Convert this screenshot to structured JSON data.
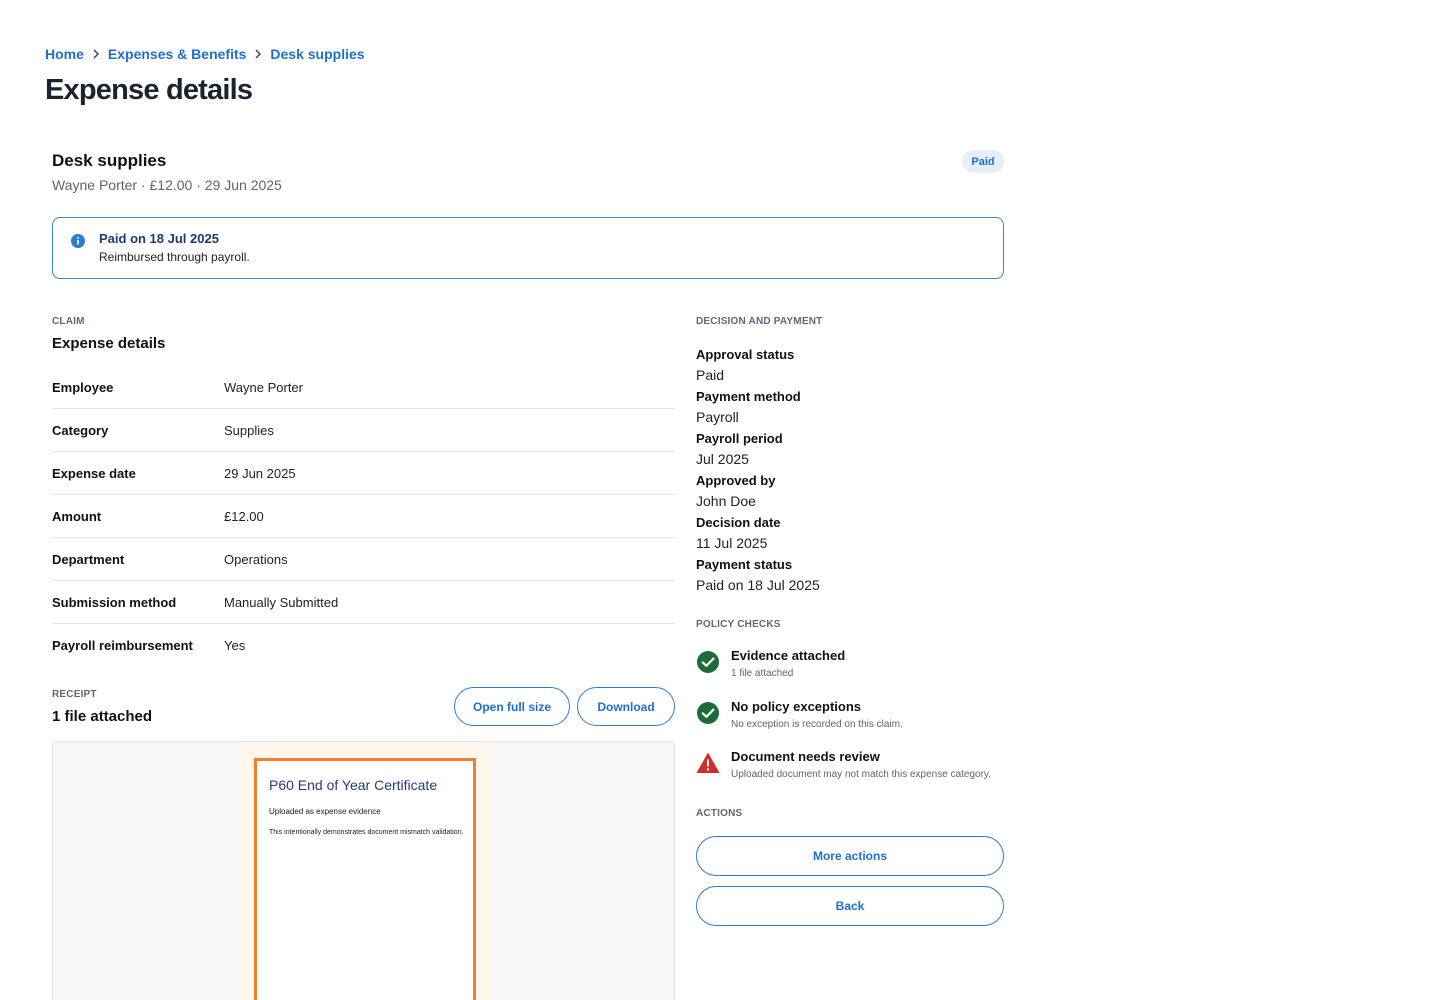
{
  "breadcrumb": {
    "items": [
      "Home",
      "Expenses & Benefits",
      "Desk supplies"
    ]
  },
  "page_title": "Expense details",
  "expense": {
    "title": "Desk supplies",
    "subtitle": "Wayne Porter · £12.00 · 29 Jun 2025",
    "status_badge": "Paid"
  },
  "info_banner": {
    "icon": "info-icon",
    "title": "Paid on 18 Jul 2025",
    "text": "Reimbursed through payroll."
  },
  "claim": {
    "section_label": "CLAIM",
    "heading": "Expense details",
    "rows": [
      {
        "key": "Employee",
        "value": "Wayne Porter"
      },
      {
        "key": "Category",
        "value": "Supplies"
      },
      {
        "key": "Expense date",
        "value": "29 Jun 2025"
      },
      {
        "key": "Amount",
        "value": "£12.00"
      },
      {
        "key": "Department",
        "value": "Operations"
      },
      {
        "key": "Submission method",
        "value": "Manually Submitted"
      },
      {
        "key": "Payroll reimbursement",
        "value": "Yes"
      }
    ]
  },
  "receipt": {
    "section_label": "RECEIPT",
    "heading": "1 file attached",
    "open_full_size_label": "Open full size",
    "download_label": "Download",
    "document": {
      "title": "P60 End of Year Certificate",
      "line1": "Uploaded as expense evidence",
      "line2": "This intentionally demonstrates document mismatch validation."
    }
  },
  "decision": {
    "section_label": "DECISION AND PAYMENT",
    "items": [
      {
        "key": "Approval status",
        "value": "Paid"
      },
      {
        "key": "Payment method",
        "value": "Payroll"
      },
      {
        "key": "Payroll period",
        "value": "Jul 2025"
      },
      {
        "key": "Approved by",
        "value": "John Doe"
      },
      {
        "key": "Decision date",
        "value": "11 Jul 2025"
      },
      {
        "key": "Payment status",
        "value": "Paid on 18 Jul 2025"
      }
    ]
  },
  "policy_checks": {
    "section_label": "POLICY CHECKS",
    "items": [
      {
        "title": "Evidence attached",
        "subtitle": "1 file attached",
        "icon": "check-circle-icon",
        "status_color": "#1e6b3a"
      },
      {
        "title": "No policy exceptions",
        "subtitle": "No exception is recorded on this claim.",
        "icon": "check-circle-icon",
        "status_color": "#1e6b3a"
      },
      {
        "title": "Document needs review",
        "subtitle": "Uploaded document may not match this expense category.",
        "icon": "warning-triangle-icon",
        "status_color": "#d42b2b"
      }
    ]
  },
  "actions": {
    "section_label": "ACTIONS",
    "more_actions_label": "More actions",
    "back_label": "Back"
  },
  "colors": {
    "accent": "#1f6fd1",
    "success": "#1e6b3a",
    "warning": "#d42b2b",
    "receipt_border": "#f07f2a"
  }
}
